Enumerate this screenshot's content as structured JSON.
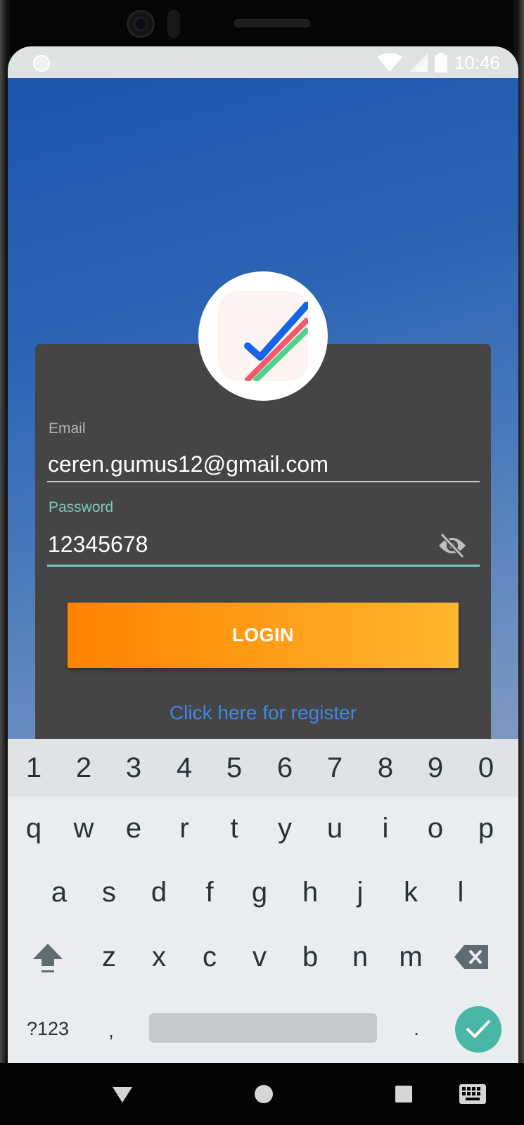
{
  "status_bar": {
    "time": "10:46"
  },
  "login_form": {
    "email_label": "Email",
    "email_value": "ceren.gumus12@gmail.com",
    "password_label": "Password",
    "password_value": "12345678",
    "login_button": "LOGIN",
    "register_link": "Click here for register"
  },
  "keyboard": {
    "number_row": [
      "1",
      "2",
      "3",
      "4",
      "5",
      "6",
      "7",
      "8",
      "9",
      "0"
    ],
    "row1": [
      "q",
      "w",
      "e",
      "r",
      "t",
      "y",
      "u",
      "i",
      "o",
      "p"
    ],
    "row2": [
      "a",
      "s",
      "d",
      "f",
      "g",
      "h",
      "j",
      "k",
      "l"
    ],
    "row3": [
      "z",
      "x",
      "c",
      "v",
      "b",
      "n",
      "m"
    ],
    "symbols_key": "?123",
    "comma_key": ",",
    "period_key": "."
  },
  "colors": {
    "accent_teal": "#4ab6a5",
    "login_orange": "#ff8200",
    "link_blue": "#3f88e6",
    "card_gray": "#454545"
  },
  "icons": [
    "wifi-icon",
    "signal-icon",
    "battery-icon",
    "app-logo-checkmark",
    "visibility-off-icon",
    "shift-icon",
    "backspace-icon",
    "checkmark-icon",
    "back-triangle-icon",
    "home-circle-icon",
    "recents-square-icon",
    "keyboard-icon"
  ]
}
